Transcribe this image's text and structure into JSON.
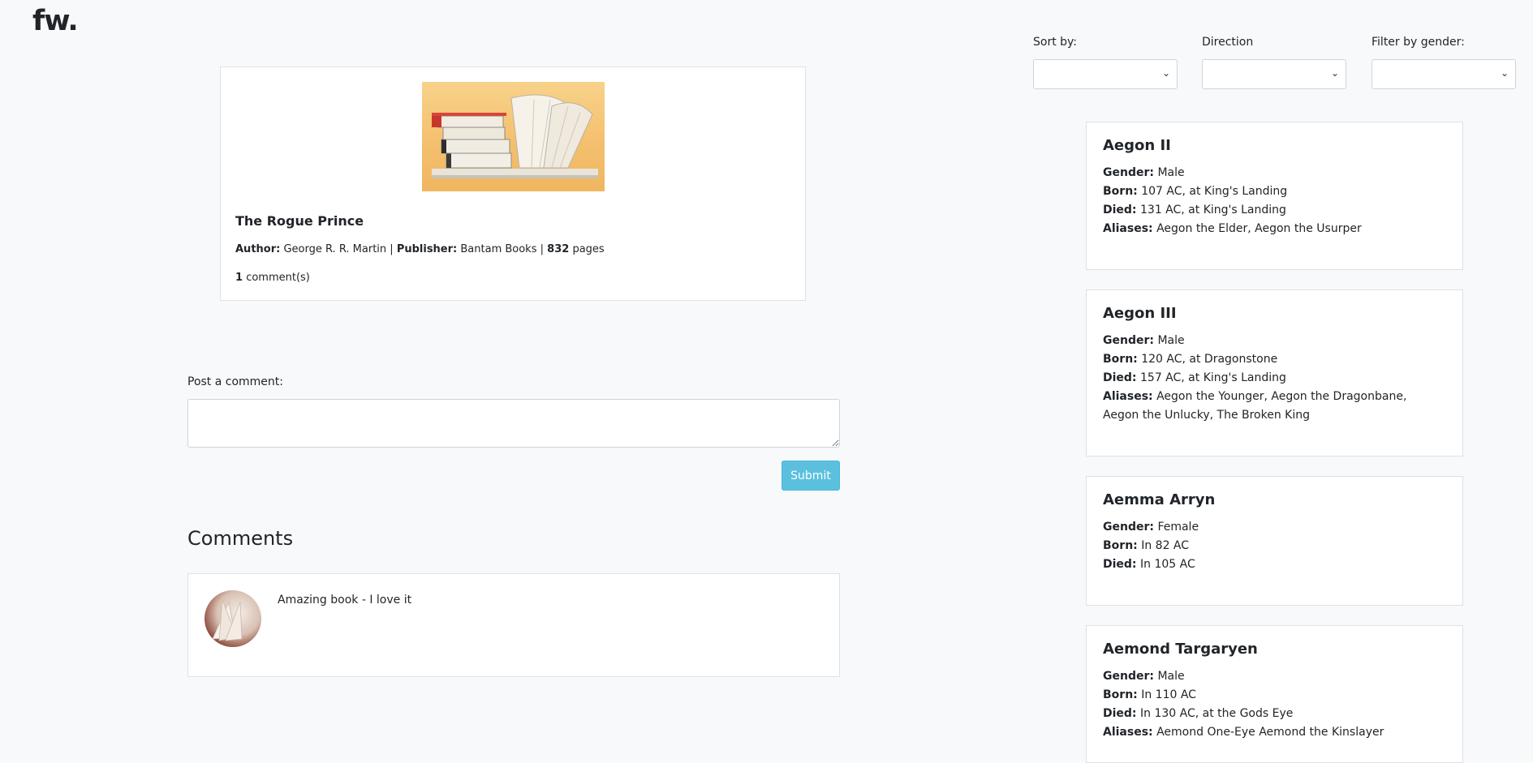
{
  "logo": "fw.",
  "book": {
    "title": "The Rogue Prince",
    "author_label": "Author:",
    "author": "George R. R. Martin",
    "publisher_label": "Publisher:",
    "publisher": "Bantam Books",
    "pages": "832",
    "pages_label": "pages",
    "sep": "|",
    "comment_count": "1",
    "comment_count_label": "comment(s)"
  },
  "post": {
    "label": "Post a comment:",
    "placeholder": "",
    "submit_label": "Submit"
  },
  "comments": {
    "heading": "Comments",
    "items": [
      {
        "text": "Amazing book - I love it"
      }
    ]
  },
  "controls": {
    "sort_label": "Sort by:",
    "direction_label": "Direction",
    "filter_label": "Filter by gender:"
  },
  "labels": {
    "gender": "Gender:",
    "born": "Born:",
    "died": "Died:",
    "aliases": "Aliases:"
  },
  "characters": [
    {
      "name": "Aegon II",
      "gender": "Male",
      "born": "107 AC, at King's Landing",
      "died": "131 AC, at King's Landing",
      "aliases": "Aegon the Elder, Aegon the Usurper"
    },
    {
      "name": "Aegon III",
      "gender": "Male",
      "born": "120 AC, at Dragonstone",
      "died": "157 AC, at King's Landing",
      "aliases": "Aegon the Younger, Aegon the Dragonbane, Aegon the Unlucky, The Broken King"
    },
    {
      "name": "Aemma Arryn",
      "gender": "Female",
      "born": "In 82 AC",
      "died": "In 105 AC",
      "aliases": ""
    },
    {
      "name": "Aemond Targaryen",
      "gender": "Male",
      "born": "In 110 AC",
      "died": "In 130 AC, at the Gods Eye",
      "aliases": "Aemond One-Eye Aemond the Kinslayer"
    }
  ]
}
